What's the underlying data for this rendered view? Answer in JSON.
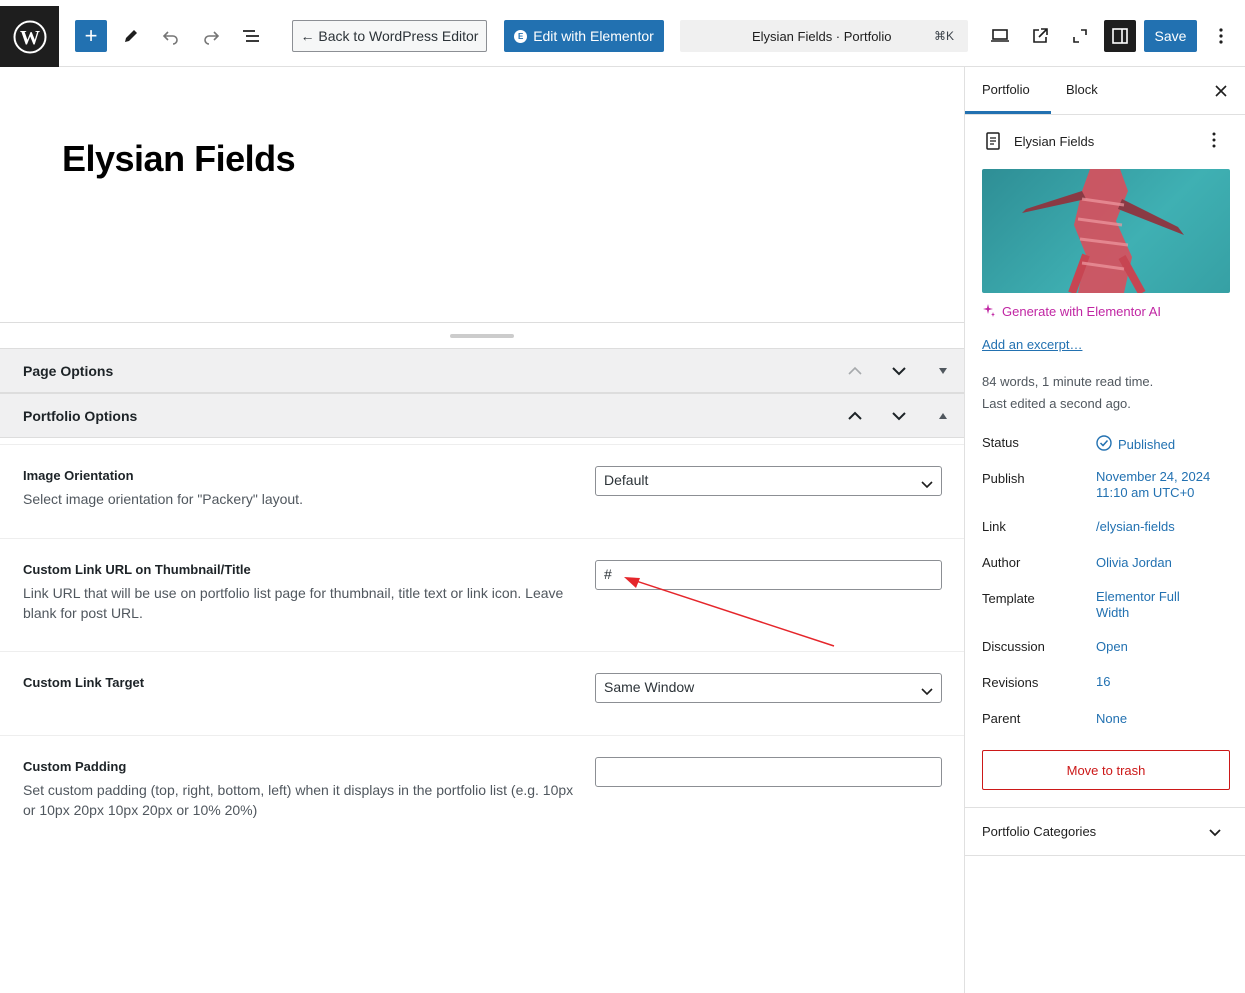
{
  "toolbar": {
    "back_label": "← Back to WordPress Editor",
    "elementor_label": "Edit with Elementor",
    "elementor_badge": "E",
    "command_title": "Elysian Fields · Portfolio",
    "command_shortcut": "⌘K",
    "save_label": "Save",
    "inserter_label": "+"
  },
  "canvas": {
    "post_title": "Elysian Fields"
  },
  "metaboxes": {
    "page_options_title": "Page Options",
    "portfolio_options_title": "Portfolio Options"
  },
  "portfolio_options": [
    {
      "label": "Image Orientation",
      "desc": "Select image orientation for \"Packery\" layout.",
      "value": "Default"
    },
    {
      "label": "Custom Link URL on Thumbnail/Title",
      "desc": "Link URL that will be use on portfolio list page for thumbnail, title text or link icon. Leave blank for post URL.",
      "value": "#"
    },
    {
      "label": "Custom Link Target",
      "desc": "",
      "value": "Same Window"
    },
    {
      "label": "Custom Padding",
      "desc": "Set custom padding (top, right, bottom, left) when it displays in the portfolio list (e.g. 10px or 10px 20px 10px 20px or 10% 20%)",
      "value": ""
    }
  ],
  "sidebar": {
    "tabs": [
      "Portfolio",
      "Block"
    ],
    "post_title": "Elysian Fields",
    "generate_ai": "Generate with Elementor AI",
    "add_excerpt": "Add an excerpt…",
    "words": "84 words, 1 minute read time.",
    "last_edited": "Last edited a second ago.",
    "rows": [
      {
        "label": "Status",
        "value": "Published"
      },
      {
        "label": "Publish",
        "value": "November 24, 2024\n11:10 am UTC+0"
      },
      {
        "label": "Link",
        "value": "/elysian-fields"
      },
      {
        "label": "Author",
        "value": "Olivia Jordan"
      },
      {
        "label": "Template",
        "value": "Elementor Full\nWidth"
      },
      {
        "label": "Discussion",
        "value": "Open"
      },
      {
        "label": "Revisions",
        "value": "16"
      },
      {
        "label": "Parent",
        "value": "None"
      }
    ],
    "trash_label": "Move to trash",
    "categories_title": "Portfolio Categories"
  },
  "colors": {
    "accent": "#2271b1",
    "danger": "#cc1818",
    "ai": "#c026a3",
    "annotation": "#e5262b"
  }
}
